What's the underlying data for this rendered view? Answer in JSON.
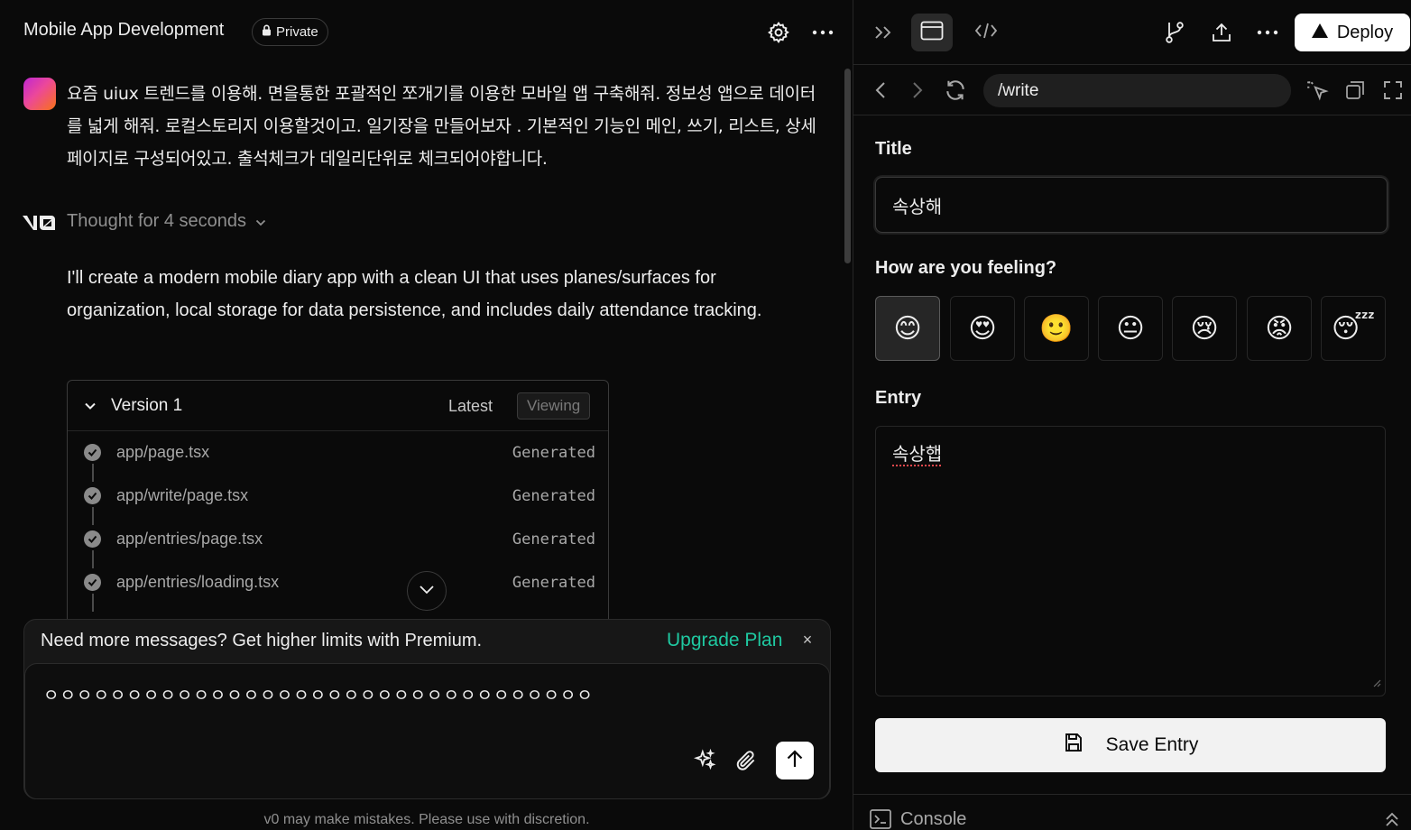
{
  "header": {
    "project_title": "Mobile App Development",
    "visibility_badge": "Private"
  },
  "conversation": {
    "user_message": "요즘 uiux 트렌드를 이용해. 면을통한 포괄적인 쪼개기를 이용한 모바일 앱 구축해줘. 정보성 앱으로 데이터를 넓게 해줘. 로컬스토리지 이용할것이고. 일기장을 만들어보자 . 기본적인 기능인 메인, 쓰기, 리스트, 상세페이지로 구성되어있고. 출석체크가 데일리단위로 체크되어야합니다.",
    "thought_label": "Thought for 4 seconds",
    "assistant_message": "I'll create a modern mobile diary app with a clean UI that uses planes/surfaces for organization, local storage for data persistence, and includes daily attendance tracking."
  },
  "version_card": {
    "title": "Version 1",
    "latest_label": "Latest",
    "viewing_label": "Viewing",
    "files": [
      {
        "name": "app/page.tsx",
        "status": "Generated"
      },
      {
        "name": "app/write/page.tsx",
        "status": "Generated"
      },
      {
        "name": "app/entries/page.tsx",
        "status": "Generated"
      },
      {
        "name": "app/entries/loading.tsx",
        "status": "Generated"
      }
    ]
  },
  "composer": {
    "upsell_text": "Need more messages? Get higher limits with Premium.",
    "upsell_link": "Upgrade Plan",
    "upsell_close": "×",
    "input_value": "ㅇㅇㅇㅇㅇㅇㅇㅇㅇㅇㅇㅇㅇㅇㅇㅇㅇㅇㅇㅇㅇㅇㅇㅇㅇㅇㅇㅇㅇㅇㅇㅇㅇ"
  },
  "disclaimer": "v0 may make mistakes. Please use with discretion.",
  "preview_toolbar": {
    "deploy_label": "Deploy",
    "url": "/write"
  },
  "write_form": {
    "title_label": "Title",
    "title_value": "속상해",
    "feeling_label": "How are you feeling?",
    "moods": [
      "😊",
      "😍",
      "🙂",
      "😐",
      "😢",
      "😡",
      "😴"
    ],
    "selected_mood_index": 0,
    "entry_label": "Entry",
    "entry_value": "속상햅",
    "save_label": "Save Entry"
  },
  "console": {
    "label": "Console"
  },
  "colors": {
    "background": "#0a0a0a",
    "accent_link": "#1fc9a1",
    "button_light": "#ffffff"
  }
}
